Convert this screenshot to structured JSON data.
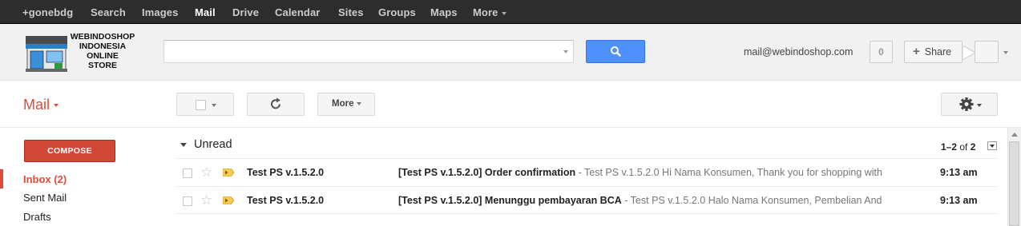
{
  "topbar": {
    "items": [
      {
        "label": "+gonebdg"
      },
      {
        "label": "Search"
      },
      {
        "label": "Images"
      },
      {
        "label": "Mail"
      },
      {
        "label": "Drive"
      },
      {
        "label": "Calendar"
      },
      {
        "label": "Sites"
      },
      {
        "label": "Groups"
      },
      {
        "label": "Maps"
      },
      {
        "label": "More"
      }
    ],
    "active": "Mail"
  },
  "header": {
    "logo_text": [
      "WEBINDOSHOP",
      "INDONESIA",
      "ONLINE",
      "STORE"
    ],
    "logo_icon": "storefront-icon",
    "search": {
      "value": "",
      "placeholder": ""
    },
    "search_button_icon": "magnifier-icon",
    "account_email": "mail@webindoshop.com",
    "notification_count": "0",
    "share_label": "Share"
  },
  "toolbar": {
    "app_label": "Mail",
    "more_label": "More",
    "refresh_icon": "refresh-icon",
    "settings_icon": "gear-icon"
  },
  "sidebar": {
    "compose_label": "COMPOSE",
    "items": [
      {
        "label": "Inbox (2)",
        "active": true
      },
      {
        "label": "Sent Mail",
        "active": false
      },
      {
        "label": "Drafts",
        "active": false
      }
    ]
  },
  "inbox": {
    "section_title": "Unread",
    "pager": {
      "range": "1–2",
      "of_label": "of",
      "total": "2"
    },
    "rows": [
      {
        "sender": "Test PS v.1.5.2.0",
        "subject": "[Test PS v.1.5.2.0] Order confirmation",
        "snippet": "Test PS v.1.5.2.0 Hi Nama Konsumen, Thank you for shopping with",
        "time": "9:13 am"
      },
      {
        "sender": "Test PS v.1.5.2.0",
        "subject": "[Test PS v.1.5.2.0] Menunggu pembayaran BCA",
        "snippet": "Test PS v.1.5.2.0 Halo Nama Konsumen, Pembelian And",
        "time": "9:13 am"
      }
    ]
  },
  "colors": {
    "topbar_bg": "#2d2d2d",
    "accent_red": "#dd4b39",
    "compose_red": "#d14836",
    "search_blue": "#4d90fe",
    "important_yellow": "#f7cb4d"
  }
}
